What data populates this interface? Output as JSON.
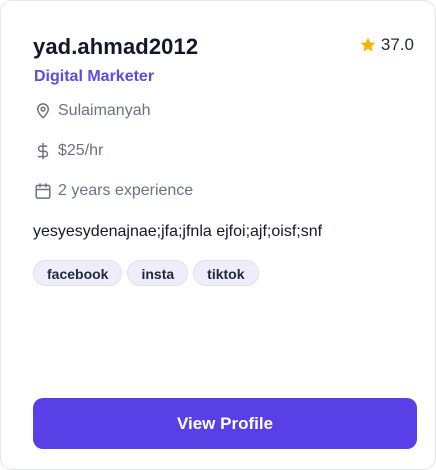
{
  "profile": {
    "username": "yad.ahmad2012",
    "rating": "37.0",
    "role": "Digital Marketer",
    "location": "Sulaimanyah",
    "rate": "$25/hr",
    "experience": "2 years experience",
    "description": "yesyesydenajnae;jfa;jfnla ejfoi;ajf;oisf;snf",
    "tags": [
      "facebook",
      "insta",
      "tiktok"
    ],
    "button_label": "View Profile"
  },
  "icons": {
    "rating": "star-icon",
    "location": "map-pin-icon",
    "rate": "dollar-icon",
    "experience": "calendar-icon"
  },
  "colors": {
    "accent": "#5840e6",
    "role_text": "#5b4ce0",
    "star": "#f5b400",
    "tag_bg": "#eeedf9",
    "muted_text": "#6b7280"
  }
}
